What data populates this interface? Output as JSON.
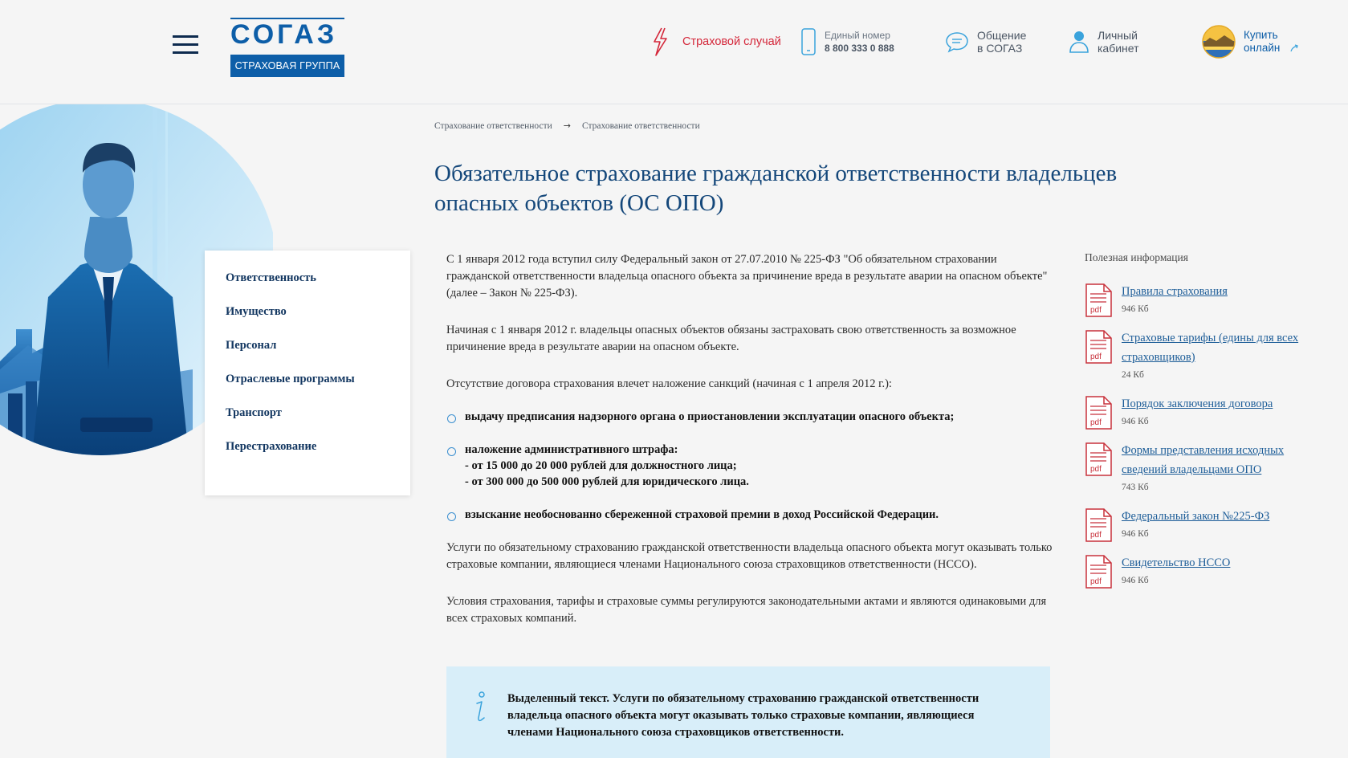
{
  "header": {
    "logo_text": "СОГАЗ",
    "logo_subtitle": "СТРАХОВАЯ ГРУППА",
    "claim_label": "Страховой случай",
    "phone_caption": "Единый номер",
    "phone_number": "8 800 333 0 888",
    "chat_line1": "Общение",
    "chat_line2": "в СОГАЗ",
    "cabinet_line1": "Личный",
    "cabinet_line2": "кабинет",
    "buy_line1": "Купить",
    "buy_line2": "онлайн"
  },
  "breadcrumb": [
    "Страхование ответственности",
    "Страхование ответственности"
  ],
  "page_title": "Обязательное страхование гражданской ответственности владельцев опасных объектов (ОС ОПО)",
  "sidemenu": [
    "Ответственность",
    "Имущество",
    "Персонал",
    "Отраслевые программы",
    "Транспорт",
    "Перестрахование"
  ],
  "content": {
    "p1": "С 1 января 2012 года вступил силу Федеральный закон от 27.07.2010 № 225-ФЗ \"Об обязательном страховании гражданской ответственности владельца опасного объекта за причинение вреда в результате аварии на опасном объекте\" (далее – Закон № 225-ФЗ).",
    "p2": "Начиная с 1 января 2012 г. владельцы опасных объектов обязаны застраховать свою ответственность за возможное причинение вреда в результате аварии на опасном объекте.",
    "p3": "Отсутствие договора страхования влечет наложение санкций (начиная с 1 апреля 2012 г.):",
    "bullet1": "выдачу предписания надзорного органа о приостановлении эксплуатации опасного объекта;",
    "bullet2": "наложение административного штрафа:",
    "bullet2_sub1": "- от 15 000 до 20 000 рублей для должностного лица;",
    "bullet2_sub2": "- от 300 000 до 500 000 рублей для юридического лица.",
    "bullet3": "взыскание необоснованно сбереженной страховой премии в доход Российской Федерации.",
    "p4": "Услуги по обязательному страхованию гражданской ответственности владельца опасного объекта могут оказывать только страховые компании, являющиеся членами Национального союза страховщиков ответственности (НССО).",
    "p5": "Условия страхования, тарифы и страховые суммы регулируются законодательными актами и являются одинаковыми для всех страховых компаний.",
    "highlight": "Выделенный текст. Услуги по обязательному страхованию гражданской ответственности владельца опасного объекта могут оказывать только страховые компании, являющиеся членами Национального союза страховщиков ответственности."
  },
  "useful": {
    "heading": "Полезная информация",
    "pdf_label": "pdf",
    "docs": [
      {
        "title": "Правила страхования",
        "size": "946 Кб"
      },
      {
        "title": "Страховые тарифы (едины для всех страховщиков)",
        "size": "24 Кб"
      },
      {
        "title": "Порядок заключения договора",
        "size": "946 Кб"
      },
      {
        "title": "Формы представления исходных сведений владельцами ОПО",
        "size": "743 Кб"
      },
      {
        "title": "Федеральный закон №225-ФЗ",
        "size": "946 Кб"
      },
      {
        "title": "Свидетельство НССО",
        "size": "946 Кб"
      }
    ]
  },
  "colors": {
    "brand_blue": "#0d5ea8",
    "title_blue": "#14477a",
    "claim_red": "#d4273a",
    "info_bg": "#d8eef9"
  }
}
